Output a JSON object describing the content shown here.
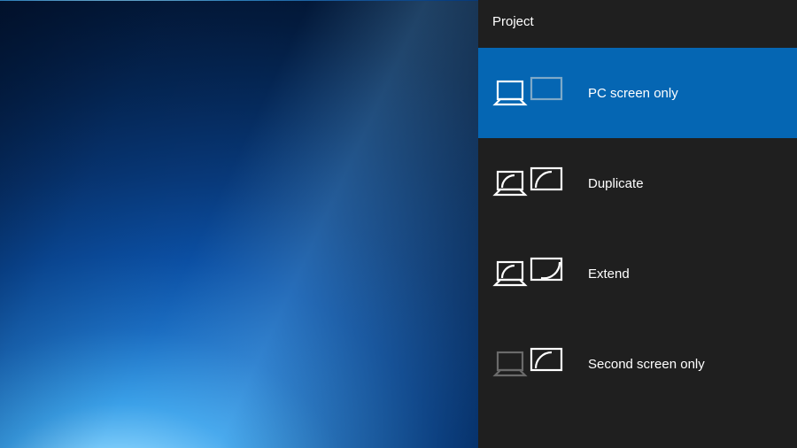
{
  "panel": {
    "title": "Project",
    "options": [
      {
        "id": "pc-only",
        "label": "PC screen only",
        "selected": true,
        "dim_secondary": true,
        "dim_primary": false
      },
      {
        "id": "duplicate",
        "label": "Duplicate",
        "selected": false,
        "dim_secondary": false,
        "dim_primary": false
      },
      {
        "id": "extend",
        "label": "Extend",
        "selected": false,
        "dim_secondary": false,
        "dim_primary": false
      },
      {
        "id": "second-only",
        "label": "Second screen only",
        "selected": false,
        "dim_secondary": false,
        "dim_primary": true
      }
    ]
  },
  "colors": {
    "panel_bg": "#1f1f1f",
    "selected_bg": "#0566b3",
    "dim_stroke": "#6a6a6a",
    "stroke": "#ffffff"
  }
}
